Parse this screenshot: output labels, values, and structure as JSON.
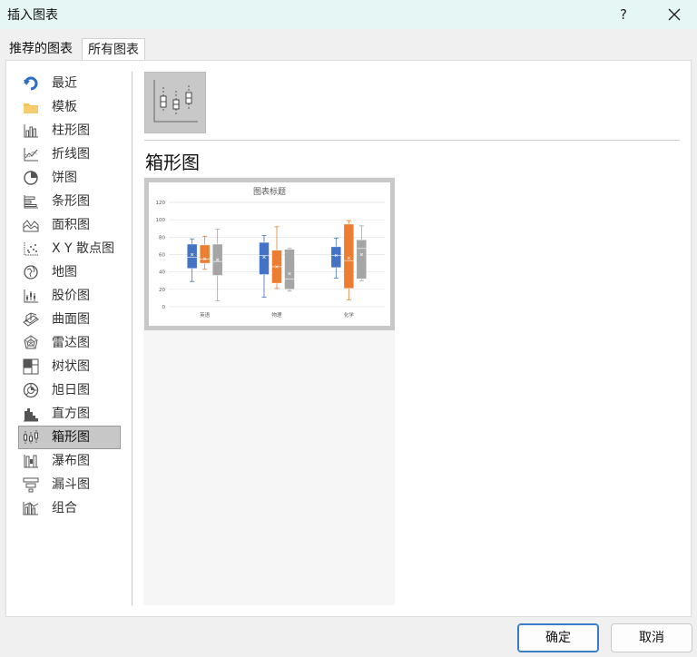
{
  "window": {
    "title": "插入图表",
    "help_label": "?"
  },
  "tabs": [
    {
      "label": "推荐的图表"
    },
    {
      "label": "所有图表"
    }
  ],
  "sidebar": {
    "items": [
      {
        "label": "最近",
        "icon": "recent-icon"
      },
      {
        "label": "模板",
        "icon": "folder-icon"
      },
      {
        "label": "柱形图",
        "icon": "column-chart-icon"
      },
      {
        "label": "折线图",
        "icon": "line-chart-icon"
      },
      {
        "label": "饼图",
        "icon": "pie-chart-icon"
      },
      {
        "label": "条形图",
        "icon": "bar-chart-icon"
      },
      {
        "label": "面积图",
        "icon": "area-chart-icon"
      },
      {
        "label": "X Y 散点图",
        "icon": "scatter-chart-icon"
      },
      {
        "label": "地图",
        "icon": "map-chart-icon"
      },
      {
        "label": "股价图",
        "icon": "stock-chart-icon"
      },
      {
        "label": "曲面图",
        "icon": "surface-chart-icon"
      },
      {
        "label": "雷达图",
        "icon": "radar-chart-icon"
      },
      {
        "label": "树状图",
        "icon": "treemap-chart-icon"
      },
      {
        "label": "旭日图",
        "icon": "sunburst-chart-icon"
      },
      {
        "label": "直方图",
        "icon": "histogram-chart-icon"
      },
      {
        "label": "箱形图",
        "icon": "box-whisker-chart-icon"
      },
      {
        "label": "瀑布图",
        "icon": "waterfall-chart-icon"
      },
      {
        "label": "漏斗图",
        "icon": "funnel-chart-icon"
      },
      {
        "label": "组合",
        "icon": "combo-chart-icon"
      }
    ],
    "selected_index": 15
  },
  "content": {
    "chart_type_name": "箱形图"
  },
  "buttons": {
    "ok_label": "确定",
    "cancel_label": "取消"
  },
  "colors": {
    "series_blue": "#4472c4",
    "series_orange": "#ed7d31",
    "series_gray": "#a5a5a5",
    "selected_bg": "#c7c7c7"
  },
  "chart_data": {
    "type": "box",
    "title": "图表标题",
    "categories": [
      "英语",
      "物理",
      "化学"
    ],
    "ylim": [
      0,
      120
    ],
    "yticks": [
      0,
      20,
      40,
      60,
      80,
      100,
      120
    ],
    "grid": true,
    "series": [
      {
        "boxes": [
          {
            "min": 29,
            "q1": 44,
            "median": 57,
            "q3": 72,
            "max": 78,
            "mean": 60
          },
          {
            "min": 11,
            "q1": 37,
            "median": 59,
            "q3": 74,
            "max": 82,
            "mean": 57
          },
          {
            "min": 33,
            "q1": 45,
            "median": 59,
            "q3": 69,
            "max": 79,
            "mean": 59
          }
        ]
      },
      {
        "boxes": [
          {
            "min": 43,
            "q1": 50,
            "median": 55,
            "q3": 71,
            "max": 81,
            "mean": 55
          },
          {
            "min": 21,
            "q1": 27,
            "median": 46,
            "q3": 65,
            "max": 92,
            "mean": 46
          },
          {
            "min": 8,
            "q1": 21,
            "median": 53,
            "q3": 95,
            "max": 99,
            "mean": 56
          }
        ]
      },
      {
        "boxes": [
          {
            "min": 7,
            "q1": 36,
            "median": 52,
            "q3": 72,
            "max": 89,
            "mean": 54
          },
          {
            "min": 18,
            "q1": 20,
            "median": 32,
            "q3": 66,
            "max": 67,
            "mean": 38
          },
          {
            "min": 30,
            "q1": 32,
            "median": 67,
            "q3": 77,
            "max": 93,
            "mean": 60
          }
        ]
      }
    ]
  }
}
